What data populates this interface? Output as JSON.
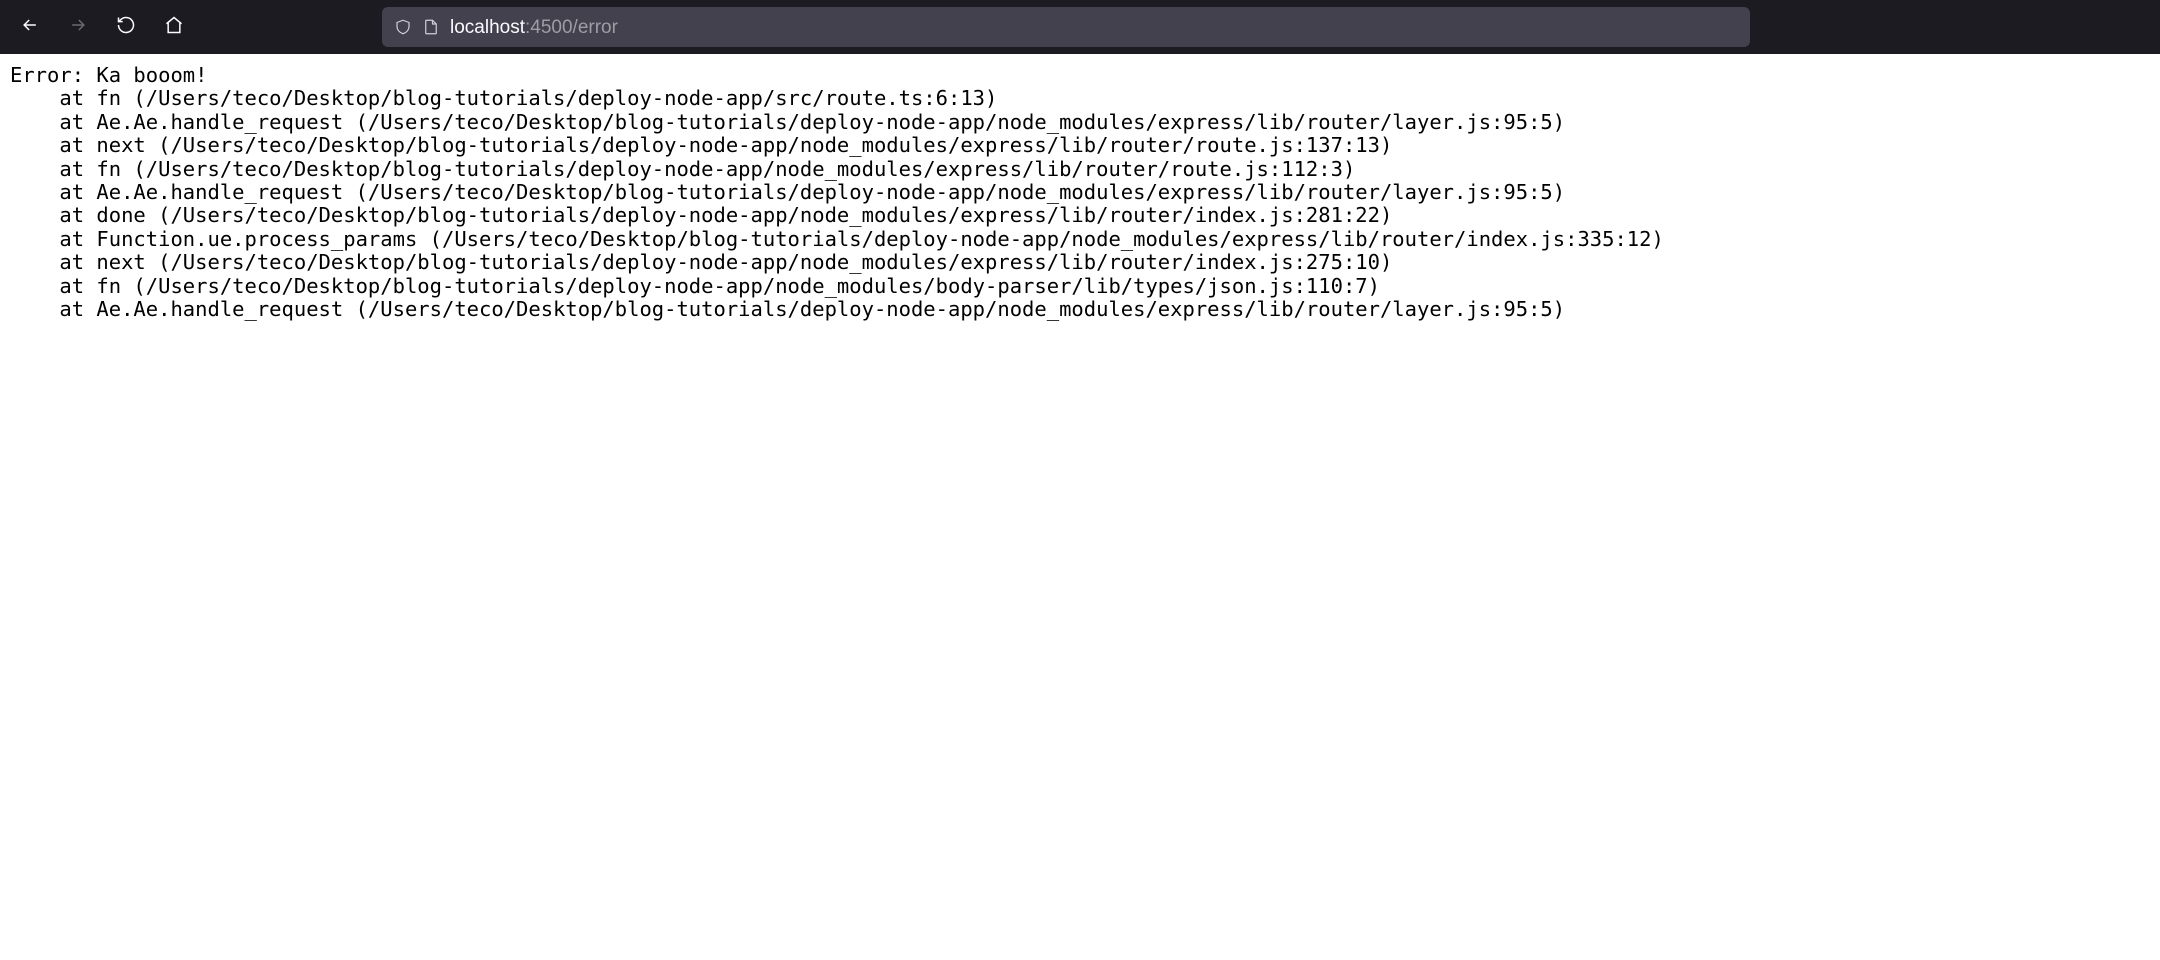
{
  "url": {
    "host": "localhost",
    "rest": ":4500/error"
  },
  "error": {
    "header": "Error: Ka booom!",
    "indent": "    ",
    "frames": [
      "at fn (/Users/teco/Desktop/blog-tutorials/deploy-node-app/src/route.ts:6:13)",
      "at Ae.Ae.handle_request (/Users/teco/Desktop/blog-tutorials/deploy-node-app/node_modules/express/lib/router/layer.js:95:5)",
      "at next (/Users/teco/Desktop/blog-tutorials/deploy-node-app/node_modules/express/lib/router/route.js:137:13)",
      "at fn (/Users/teco/Desktop/blog-tutorials/deploy-node-app/node_modules/express/lib/router/route.js:112:3)",
      "at Ae.Ae.handle_request (/Users/teco/Desktop/blog-tutorials/deploy-node-app/node_modules/express/lib/router/layer.js:95:5)",
      "at done (/Users/teco/Desktop/blog-tutorials/deploy-node-app/node_modules/express/lib/router/index.js:281:22)",
      "at Function.ue.process_params (/Users/teco/Desktop/blog-tutorials/deploy-node-app/node_modules/express/lib/router/index.js:335:12)",
      "at next (/Users/teco/Desktop/blog-tutorials/deploy-node-app/node_modules/express/lib/router/index.js:275:10)",
      "at fn (/Users/teco/Desktop/blog-tutorials/deploy-node-app/node_modules/body-parser/lib/types/json.js:110:7)",
      "at Ae.Ae.handle_request (/Users/teco/Desktop/blog-tutorials/deploy-node-app/node_modules/express/lib/router/layer.js:95:5)"
    ]
  }
}
